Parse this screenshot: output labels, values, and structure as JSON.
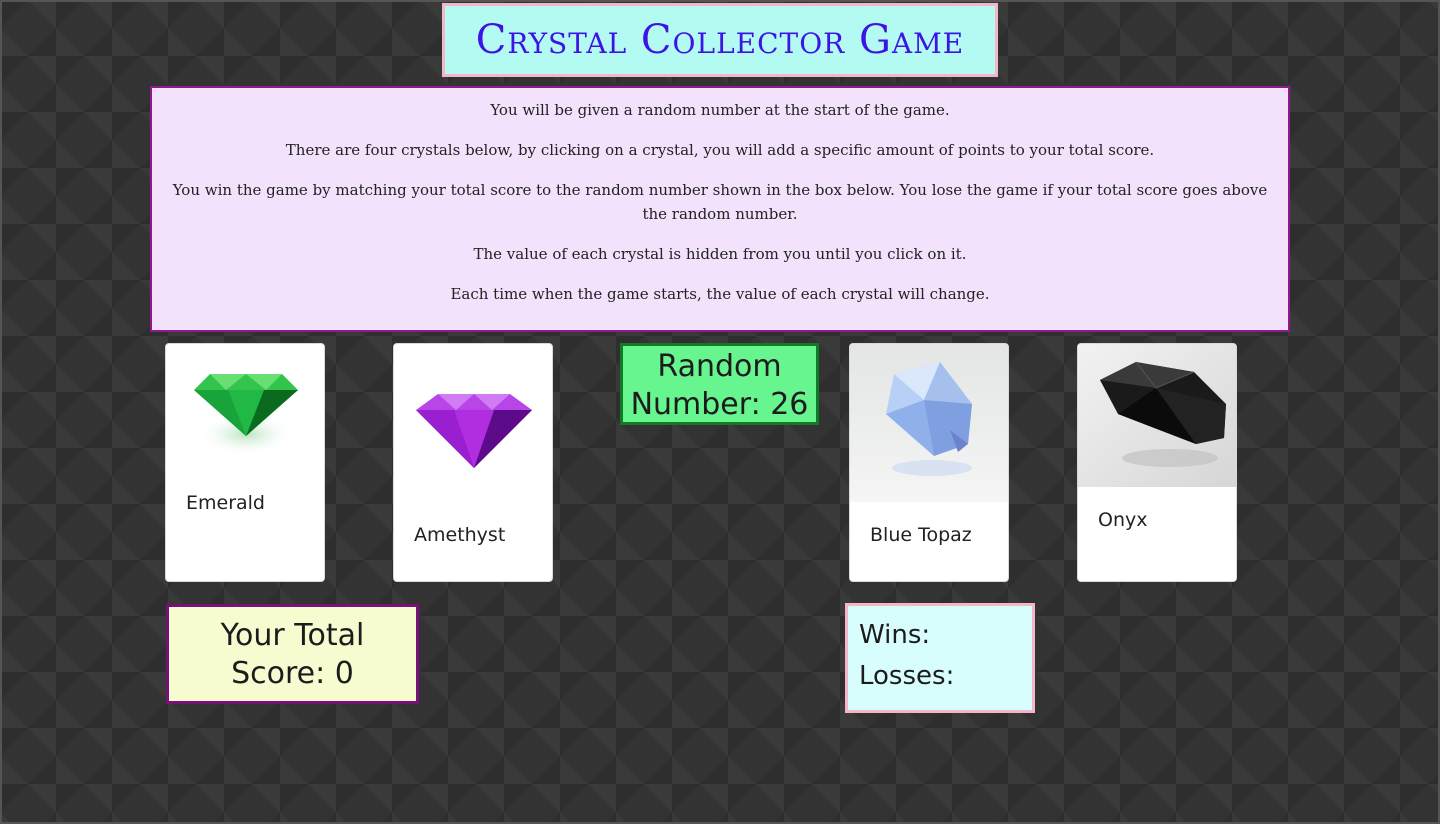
{
  "title": "Crystal Collector Game",
  "instructions": [
    "You will be given a random number at the start of the game.",
    "There are four crystals below, by clicking on a crystal, you will add a specific amount of points to your total score.",
    "You win the game by matching your total score to the random number shown in the box below. You lose the game if your total score goes above the random number.",
    "The value of each crystal is hidden from you until you click on it.",
    "Each time when the game starts, the value of each crystal will change."
  ],
  "crystals": [
    {
      "label": "Emerald",
      "icon": "emerald-icon",
      "color": "#1fa83a"
    },
    {
      "label": "Amethyst",
      "icon": "amethyst-icon",
      "color": "#9a1fd0"
    },
    {
      "label": "Blue Topaz",
      "icon": "blue-topaz-icon",
      "color": "#9ec0f0"
    },
    {
      "label": "Onyx",
      "icon": "onyx-icon",
      "color": "#111111"
    }
  ],
  "random": {
    "label": "Random Number:",
    "value": "26"
  },
  "score": {
    "label": "Your Total Score:",
    "value": "0"
  },
  "wins_label": "Wins:",
  "losses_label": "Losses:",
  "colors": {
    "title_text": "#3c14e6",
    "title_bg": "#b3fbf2",
    "instructions_bg": "#f3e2fb",
    "random_bg": "#66f58f",
    "score_bg": "#f6fbd0",
    "wl_bg": "#d7fdfd"
  }
}
